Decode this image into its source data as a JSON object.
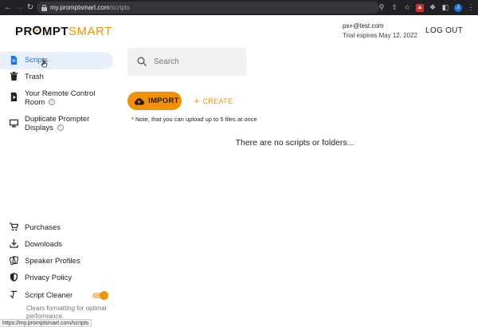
{
  "browser": {
    "url_host": "my.promptsmart.com",
    "url_path": "/scripts",
    "status_url": "https://my.promptsmart.com/scripts",
    "profile_initial": "J"
  },
  "header": {
    "logo_part1": "PR",
    "logo_part2": "MPT",
    "logo_part3": "SMART",
    "email": "ps+@test.com",
    "trial": "Trial expires May 12, 2022",
    "logout": "LOG OUT"
  },
  "sidebar": {
    "top_items": [
      {
        "label": "Scripts",
        "icon": "document-icon",
        "active": true
      },
      {
        "label": "Trash",
        "icon": "trash-icon"
      },
      {
        "label_line1": "Your Remote Control",
        "label_line2": "Room",
        "icon": "play-card-icon",
        "info": "i"
      },
      {
        "label_line1": "Duplicate Prompter",
        "label_line2": "Displays",
        "icon": "monitor-icon",
        "info": "i"
      }
    ],
    "bottom_items": [
      {
        "label": "Purchases",
        "icon": "cart-icon"
      },
      {
        "label": "Downloads",
        "icon": "download-icon"
      },
      {
        "label": "Speaker Profiles",
        "icon": "speaker-profiles-icon"
      },
      {
        "label": "Privacy Policy",
        "icon": "shield-icon"
      },
      {
        "label": "Script Cleaner",
        "icon": "clear-format-icon"
      }
    ],
    "script_cleaner_enabled": true,
    "script_cleaner_desc": "Clears formatting for optimal performance."
  },
  "main": {
    "search_placeholder": "Search",
    "import_label": "IMPORT",
    "create_label": "CREATE",
    "note": "* Note, that you can upload up to 5 files at once",
    "empty_text": "There are no scripts or folders..."
  },
  "colors": {
    "accent": "#f39200",
    "active_bg": "#e8f0fb",
    "active_text": "#1a73e8"
  }
}
